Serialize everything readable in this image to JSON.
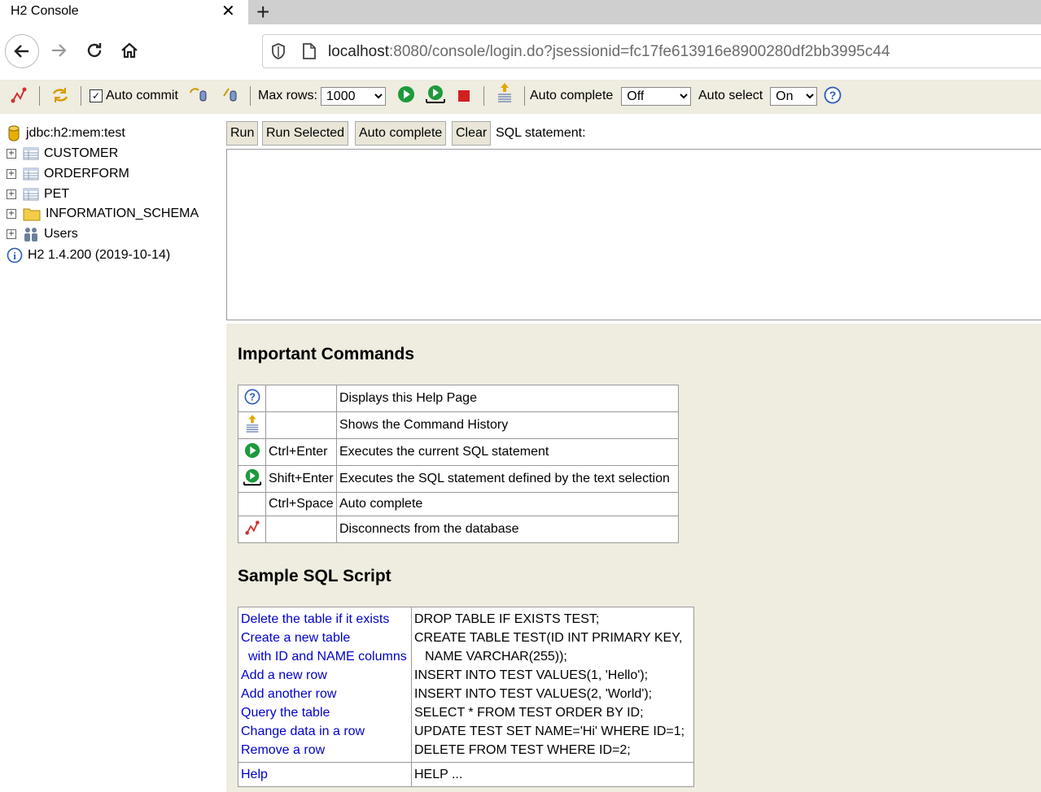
{
  "browser": {
    "tab_title": "H2 Console",
    "url_host": "localhost",
    "url_rest": ":8080/console/login.do?jsessionid=fc17fe613916e8900280df2bb3995c44"
  },
  "toolbar": {
    "auto_commit_label": "Auto commit",
    "max_rows_label": "Max rows:",
    "max_rows_value": "1000",
    "auto_complete_label": "Auto complete",
    "auto_complete_value": "Off",
    "auto_select_label": "Auto select",
    "auto_select_value": "On"
  },
  "tree": {
    "connection": "jdbc:h2:mem:test",
    "items": [
      {
        "label": "CUSTOMER",
        "icon": "table-icon"
      },
      {
        "label": "ORDERFORM",
        "icon": "table-icon"
      },
      {
        "label": "PET",
        "icon": "table-icon"
      },
      {
        "label": "INFORMATION_SCHEMA",
        "icon": "folder-icon"
      },
      {
        "label": "Users",
        "icon": "users-icon"
      }
    ],
    "version": "H2 1.4.200 (2019-10-14)"
  },
  "query": {
    "run": "Run",
    "run_selected": "Run Selected",
    "auto_complete": "Auto complete",
    "clear": "Clear",
    "sql_label": "SQL statement:"
  },
  "help": {
    "important_title": "Important Commands",
    "commands": [
      {
        "icon": "help-icon",
        "key": "",
        "desc": "Displays this Help Page"
      },
      {
        "icon": "history-icon",
        "key": "",
        "desc": "Shows the Command History"
      },
      {
        "icon": "run-icon",
        "key": "Ctrl+Enter",
        "desc": "Executes the current SQL statement"
      },
      {
        "icon": "run-selected-icon",
        "key": "Shift+Enter",
        "desc": "Executes the SQL statement defined by the text selection"
      },
      {
        "icon": "",
        "key": "Ctrl+Space",
        "desc": "Auto complete"
      },
      {
        "icon": "disconnect-icon",
        "key": "",
        "desc": "Disconnects from the database"
      }
    ],
    "sample_title": "Sample SQL Script",
    "sample": [
      {
        "label": "Delete the table if it exists",
        "sql": "DROP TABLE IF EXISTS TEST;"
      },
      {
        "label": "Create a new table",
        "label2": "with ID and NAME columns",
        "sql": "CREATE TABLE TEST(ID INT PRIMARY KEY,",
        "sql2": "NAME VARCHAR(255));"
      },
      {
        "label": "Add a new row",
        "sql": "INSERT INTO TEST VALUES(1, 'Hello');"
      },
      {
        "label": "Add another row",
        "sql": "INSERT INTO TEST VALUES(2, 'World');"
      },
      {
        "label": "Query the table",
        "sql": "SELECT * FROM TEST ORDER BY ID;"
      },
      {
        "label": "Change data in a row",
        "sql": "UPDATE TEST SET NAME='Hi' WHERE ID=1;"
      },
      {
        "label": "Remove a row",
        "sql": "DELETE FROM TEST WHERE ID=2;"
      }
    ],
    "help_label": "Help",
    "help_sql": "HELP ..."
  }
}
